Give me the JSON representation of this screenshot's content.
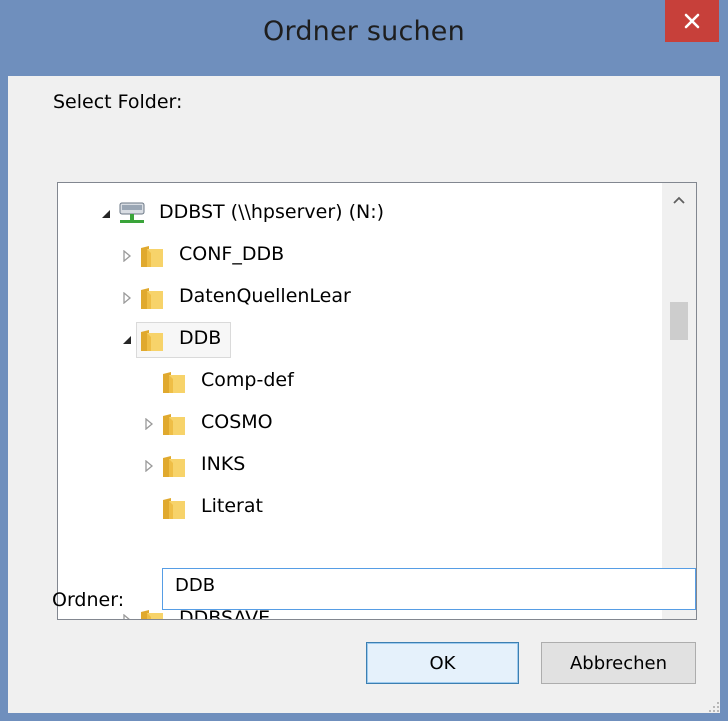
{
  "window": {
    "title": "Ordner suchen",
    "close_symbol": "✕"
  },
  "prompt_label": "Select Folder:",
  "tree": {
    "items": [
      {
        "label": "DDBST (\\\\hpserver) (N:)",
        "icon": "network-drive-icon",
        "expander": "expanded"
      },
      {
        "label": "CONF_DDB",
        "icon": "folder-icon",
        "expander": "collapsed"
      },
      {
        "label": "DatenQuellenLear",
        "icon": "folder-icon",
        "expander": "collapsed"
      },
      {
        "label": "DDB",
        "icon": "folder-icon",
        "expander": "expanded",
        "selected": true
      },
      {
        "label": "Comp-def",
        "icon": "folder-icon",
        "expander": "none"
      },
      {
        "label": "COSMO",
        "icon": "folder-icon",
        "expander": "collapsed"
      },
      {
        "label": "INKS",
        "icon": "folder-icon",
        "expander": "collapsed"
      },
      {
        "label": "Literat",
        "icon": "folder-icon",
        "expander": "none"
      },
      {
        "label": "DDBSAVE",
        "icon": "folder-icon",
        "expander": "collapsed"
      }
    ]
  },
  "folder_field": {
    "label": "Ordner:",
    "value": "DDB"
  },
  "buttons": {
    "ok": "OK",
    "cancel": "Abbrechen"
  },
  "colors": {
    "titlebar": "#6f8fbd",
    "close_button": "#c7403a",
    "dialog_background": "#f0f0f0",
    "focus_border": "#569de5"
  }
}
